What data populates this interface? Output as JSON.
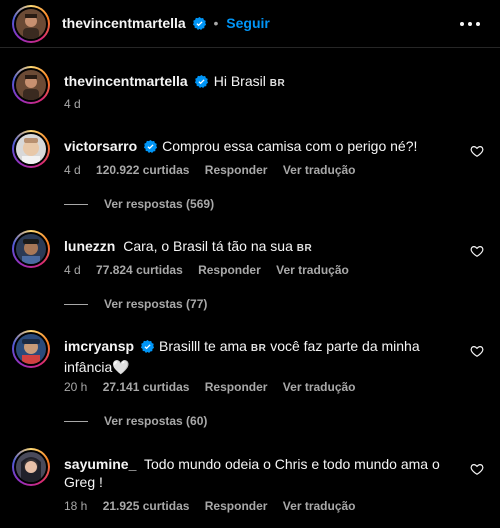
{
  "header": {
    "username": "thevincentmartella",
    "separator": "•",
    "follow_label": "Seguir"
  },
  "caption": {
    "username": "thevincentmartella",
    "text": "Hi Brasil",
    "flag": "BR",
    "time": "4 d"
  },
  "actions": {
    "reply": "Responder",
    "translate": "Ver tradução"
  },
  "comments": [
    {
      "username": "victorsarro",
      "verified": true,
      "text": "Comprou essa camisa com o perigo né?!",
      "flag": "",
      "time": "4 d",
      "likes": "120.922 curtidas",
      "view_replies": "Ver respostas (569)"
    },
    {
      "username": "lunezzn",
      "verified": false,
      "text": "Cara, o Brasil tá tão na sua",
      "flag": "BR",
      "time": "4 d",
      "likes": "77.824 curtidas",
      "view_replies": "Ver respostas (77)"
    },
    {
      "username": "imcryansp",
      "verified": true,
      "text_a": "Brasilll te ama",
      "flag": "BR",
      "text_b": "você faz parte da minha",
      "text_c": "infância",
      "emoji": "🤍",
      "time": "20 h",
      "likes": "27.141 curtidas",
      "view_replies": "Ver respostas (60)"
    },
    {
      "username": "sayumine_",
      "verified": false,
      "text_a": "Todo mundo odeia o Chris e todo mundo ama o",
      "text_b": "Greg !",
      "time": "18 h",
      "likes": "21.925 curtidas"
    }
  ],
  "colors": {
    "background": "#000000",
    "link": "#0095f6",
    "secondary": "#a8a8a8",
    "verified": "#0095f6"
  }
}
